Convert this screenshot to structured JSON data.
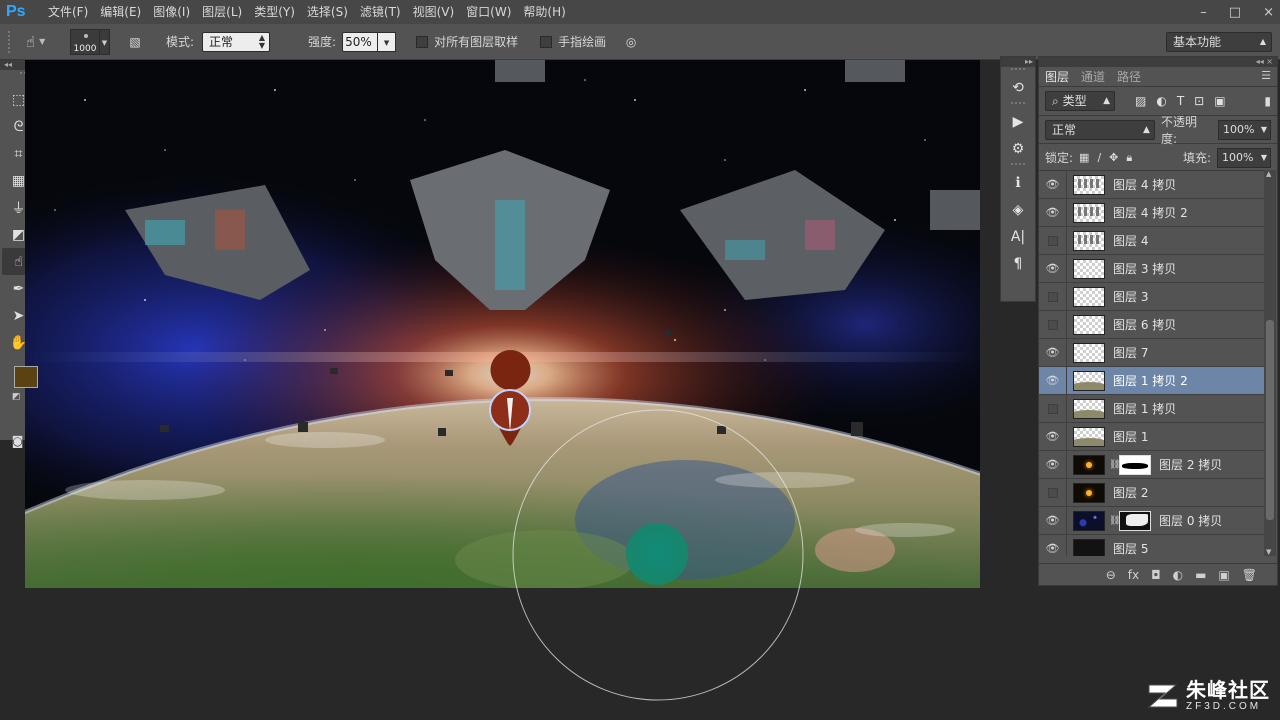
{
  "app": {
    "logo": "Ps"
  },
  "menu": [
    "文件(F)",
    "编辑(E)",
    "图像(I)",
    "图层(L)",
    "类型(Y)",
    "选择(S)",
    "滤镜(T)",
    "视图(V)",
    "窗口(W)",
    "帮助(H)"
  ],
  "window_controls": [
    "–",
    "□",
    "×"
  ],
  "options": {
    "brush_size": "1000",
    "mode_label": "模式:",
    "mode_value": "正常",
    "strength_label": "强度:",
    "strength_value": "50%",
    "sample_all_label": "对所有图层取样",
    "finger_paint_label": "手指绘画",
    "workspace": "基本功能"
  },
  "tools": {
    "items": [
      {
        "icon": "marquee-icon",
        "glyph": "⬚"
      },
      {
        "icon": "move-icon",
        "glyph": "✥"
      },
      {
        "icon": "lasso-icon",
        "glyph": "ᘓ"
      },
      {
        "icon": "magic-wand-icon",
        "glyph": "✶"
      },
      {
        "icon": "crop-icon",
        "glyph": "⌗"
      },
      {
        "icon": "eyedropper-icon",
        "glyph": "⁄"
      },
      {
        "icon": "healing-brush-icon",
        "glyph": "▦"
      },
      {
        "icon": "brush-icon",
        "glyph": "∕"
      },
      {
        "icon": "clone-stamp-icon",
        "glyph": "⏚"
      },
      {
        "icon": "history-brush-icon",
        "glyph": "↺"
      },
      {
        "icon": "eraser-icon",
        "glyph": "◩"
      },
      {
        "icon": "gradient-icon",
        "glyph": "▭"
      },
      {
        "icon": "smudge-icon",
        "glyph": "☝"
      },
      {
        "icon": "dodge-icon",
        "glyph": "●"
      },
      {
        "icon": "pen-icon",
        "glyph": "✒"
      },
      {
        "icon": "type-icon",
        "glyph": "T"
      },
      {
        "icon": "path-select-icon",
        "glyph": "➤"
      },
      {
        "icon": "rectangle-icon",
        "glyph": "■"
      },
      {
        "icon": "hand-icon",
        "glyph": "✋"
      },
      {
        "icon": "zoom-icon",
        "glyph": "⚲"
      }
    ],
    "active_index": 12,
    "foreground_color": "#5b4213",
    "background_color": "#0a0a0a"
  },
  "mini_panel_icons": [
    "history-icon",
    "actions-icon",
    "adjustments-icon",
    "info-icon",
    "3d-icon",
    "character-icon",
    "paragraph-icon"
  ],
  "mini_panel_glyphs": [
    "⟲",
    "▶",
    "⚙",
    "ℹ",
    "◈",
    "A|",
    "¶"
  ],
  "layers_panel": {
    "tabs": [
      "图层",
      "通道",
      "路径"
    ],
    "active_tab": 0,
    "filter_label": "类型",
    "blend_mode": "正常",
    "opacity_label": "不透明度:",
    "opacity_value": "100%",
    "lock_label": "锁定:",
    "fill_label": "填充:",
    "fill_value": "100%",
    "layers": [
      {
        "name": "图层 4 拷贝",
        "visible": true,
        "thumb": "ship"
      },
      {
        "name": "图层 4 拷贝 2",
        "visible": true,
        "thumb": "ship"
      },
      {
        "name": "图层 4",
        "visible": false,
        "thumb": "ship"
      },
      {
        "name": "图层 3 拷贝",
        "visible": true,
        "thumb": "plain"
      },
      {
        "name": "图层 3",
        "visible": false,
        "thumb": "plain"
      },
      {
        "name": "图层 6 拷贝",
        "visible": false,
        "thumb": "plain"
      },
      {
        "name": "图层 7",
        "visible": true,
        "thumb": "plain"
      },
      {
        "name": "图层 1 拷贝 2",
        "visible": true,
        "thumb": "earth",
        "selected": true
      },
      {
        "name": "图层 1 拷贝",
        "visible": false,
        "thumb": "earth"
      },
      {
        "name": "图层 1",
        "visible": true,
        "thumb": "earth"
      },
      {
        "name": "图层 2 拷贝",
        "visible": true,
        "thumb": "flare",
        "mask": "m1"
      },
      {
        "name": "图层 2",
        "visible": false,
        "thumb": "flare"
      },
      {
        "name": "图层 0 拷贝",
        "visible": true,
        "thumb": "stars",
        "mask": "m2"
      },
      {
        "name": "图层 5",
        "visible": true,
        "thumb": "dark"
      }
    ],
    "footer_icons": [
      "link-icon",
      "fx-icon",
      "mask-icon",
      "adjustment-layer-icon",
      "group-icon",
      "new-layer-icon",
      "trash-icon"
    ],
    "footer_glyphs": [
      "⊖",
      "fx",
      "◘",
      "◐",
      "▬",
      "▣",
      "🗑"
    ]
  },
  "watermark": {
    "title": "朱峰社区",
    "subtitle": "ZF3D.COM"
  }
}
